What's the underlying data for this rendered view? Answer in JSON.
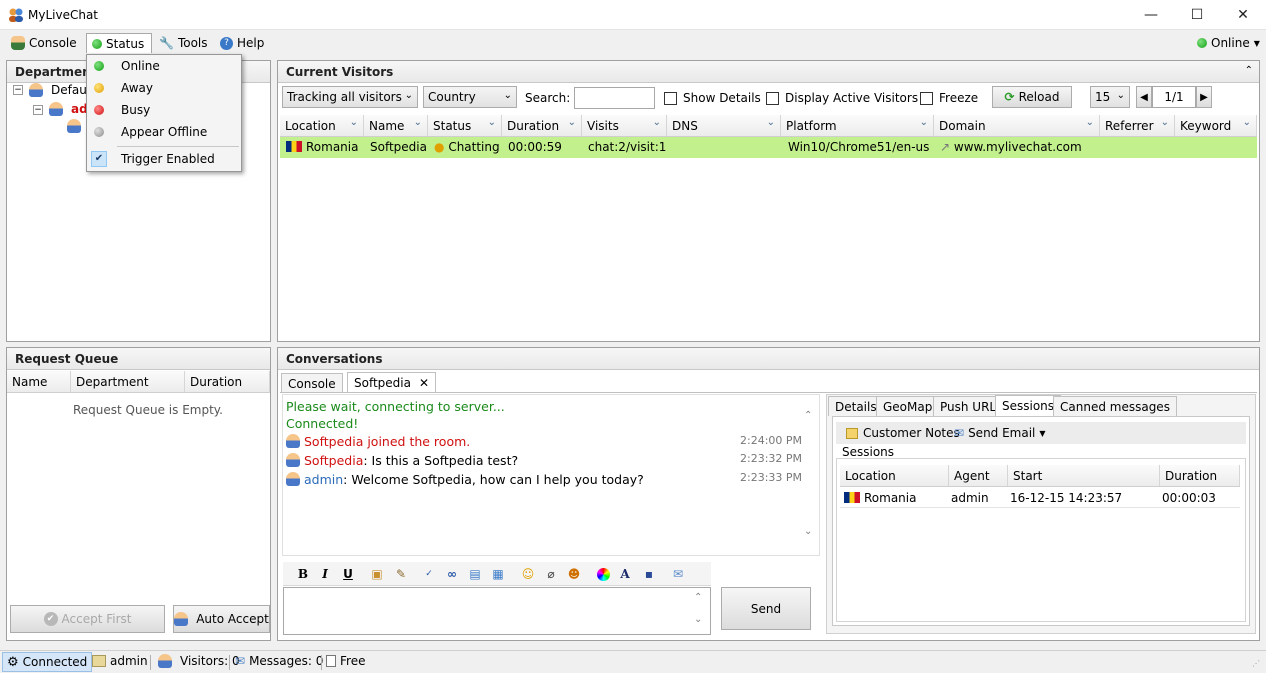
{
  "window": {
    "title": "MyLiveChat",
    "min": "—",
    "max": "☐",
    "close": "✕"
  },
  "menubar": {
    "console": "Console",
    "status": "Status",
    "tools": "Tools",
    "help": "Help",
    "online_status": "Online"
  },
  "status_menu": {
    "items": [
      {
        "label": "Online",
        "color": "#14a014"
      },
      {
        "label": "Away",
        "color": "#e0a000"
      },
      {
        "label": "Busy",
        "color": "#d01010"
      },
      {
        "label": "Appear Offline",
        "color": "#8a8a8a"
      }
    ],
    "trigger_label": "Trigger Enabled",
    "trigger_checked": true
  },
  "departments": {
    "header": "Departments",
    "tree": {
      "root": "Default",
      "agent": "adm"
    }
  },
  "visitors": {
    "header": "Current Visitors",
    "tracking_select": "Tracking all visitors",
    "country_select": "Country",
    "search_label": "Search:",
    "search_value": "",
    "show_details": "Show Details",
    "display_active": "Display Active Visitors",
    "freeze": "Freeze",
    "reload": "Reload",
    "page_size": "15",
    "page": "1/1",
    "columns": [
      "Location",
      "Name",
      "Status",
      "Duration",
      "Visits",
      "DNS",
      "Platform",
      "Domain",
      "Referrer",
      "Keyword"
    ],
    "rows": [
      {
        "location": "Romania",
        "name": "Softpedia",
        "status": "Chatting",
        "duration": "00:00:59",
        "visits": "chat:2/visit:1",
        "dns": "",
        "platform": "Win10/Chrome51/en-us",
        "domain": "www.mylivechat.com",
        "referrer": "",
        "keyword": ""
      }
    ]
  },
  "queue": {
    "header": "Request Queue",
    "columns": [
      "Name",
      "Department",
      "Duration"
    ],
    "empty": "Request Queue is Empty.",
    "accept_first": "Accept First",
    "auto_accept": "Auto Accept"
  },
  "conversations": {
    "header": "Conversations",
    "tabs": [
      "Console",
      "Softpedia"
    ],
    "messages": [
      {
        "text": "Please wait, connecting to server...",
        "kind": "system"
      },
      {
        "text": "Connected!",
        "kind": "system"
      },
      {
        "text": "Softpedia joined the room.",
        "time": "2:24:00 PM",
        "kind": "join"
      },
      {
        "sender": "Softpedia",
        "text": ": Is this a Softpedia test?",
        "time": "2:23:32 PM",
        "kind": "visitor"
      },
      {
        "sender": "admin",
        "text": ": Welcome Softpedia, how can I help you today?",
        "time": "2:23:33 PM",
        "kind": "agent"
      }
    ],
    "toolbar": [
      "B",
      "I",
      "U"
    ],
    "input_value": "",
    "send": "Send"
  },
  "details": {
    "tabs": [
      "Details",
      "GeoMap",
      "Push URL",
      "Sessions",
      "Canned messages"
    ],
    "active_tab": "Sessions",
    "customer_notes": "Customer Notes",
    "send_email": "Send Email",
    "sessions_label": "Sessions",
    "columns": [
      "Location",
      "Agent",
      "Start",
      "Duration"
    ],
    "rows": [
      {
        "location": "Romania",
        "agent": "admin",
        "start": "16-12-15 14:23:57",
        "duration": "00:00:03"
      }
    ]
  },
  "statusbar": {
    "connected": "Connected",
    "user": "admin",
    "visitors": "Visitors: 0",
    "messages": "Messages: 0",
    "free": "Free"
  },
  "colors": {
    "accent_green": "#c2f08c",
    "system_text": "#1a8a1a",
    "visitor_name": "#d01010",
    "agent_name": "#2a6ab8"
  }
}
